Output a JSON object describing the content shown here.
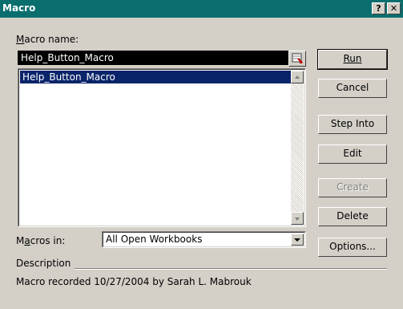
{
  "window": {
    "title": "Macro",
    "help_button": "?",
    "close_button": "✕"
  },
  "macro_name": {
    "label": "Macro name:",
    "value": "Help_Button_Macro"
  },
  "macro_list": {
    "items": [
      "Help_Button_Macro"
    ],
    "selected_index": 0
  },
  "macros_in": {
    "label": "Macros in:",
    "value": "All Open Workbooks"
  },
  "description": {
    "label": "Description",
    "text": "Macro recorded 10/27/2004 by Sarah L. Mabrouk"
  },
  "buttons": {
    "run": "Run",
    "cancel": "Cancel",
    "step_into": "Step Into",
    "edit": "Edit",
    "create": "Create",
    "delete": "Delete",
    "options": "Options..."
  },
  "colors": {
    "titlebar": "#0a6e6e",
    "selection": "#0a246a",
    "dialog_bg": "#d4d0c8"
  },
  "icons": {
    "ref": "range-select-icon",
    "scroll_up": "scroll-up-arrow-icon",
    "scroll_down": "scroll-down-arrow-icon",
    "dropdown": "dropdown-arrow-icon"
  }
}
